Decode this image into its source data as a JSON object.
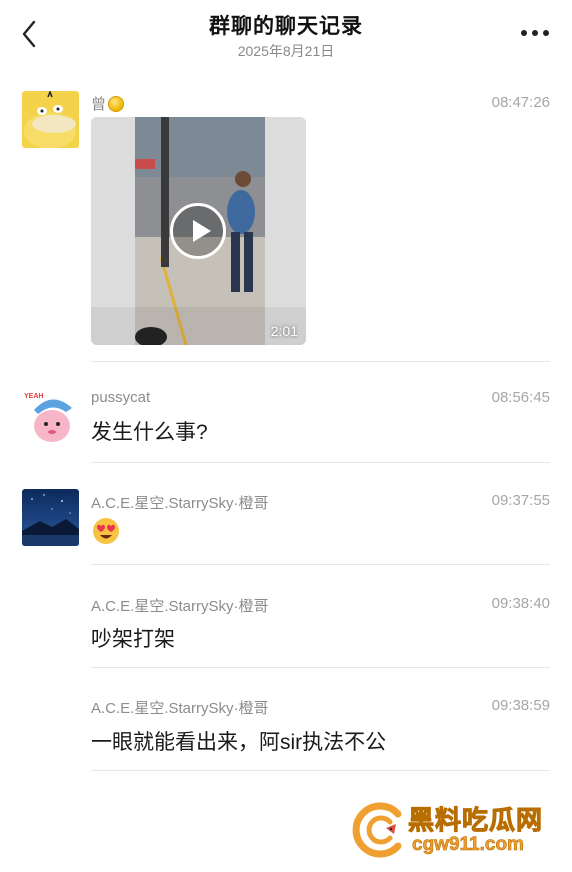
{
  "header": {
    "title": "群聊的聊天记录",
    "date": "2025年8月21日"
  },
  "messages": [
    {
      "sender": "曾",
      "time": "08:47:26",
      "type": "video",
      "video_duration": "2:01"
    },
    {
      "sender": "pussycat",
      "time": "08:56:45",
      "type": "text",
      "text": "发生什么事?"
    },
    {
      "sender": "A.C.E.星空.StarrySky·橙哥",
      "time": "09:37:55",
      "type": "emoji",
      "emoji": "heart-eyes-emoji"
    },
    {
      "sender": "A.C.E.星空.StarrySky·橙哥",
      "time": "09:38:40",
      "type": "text",
      "text": "吵架打架"
    },
    {
      "sender": "A.C.E.星空.StarrySky·橙哥",
      "time": "09:38:59",
      "type": "text",
      "text": "一眼就能看出来，阿sir执法不公"
    }
  ],
  "watermark": {
    "text": "黑料吃瓜网",
    "url": "cgw911.com"
  },
  "colors": {
    "meta_text": "#8c8c8c",
    "divider": "#e8e8e8",
    "watermark": "#f0a030"
  }
}
